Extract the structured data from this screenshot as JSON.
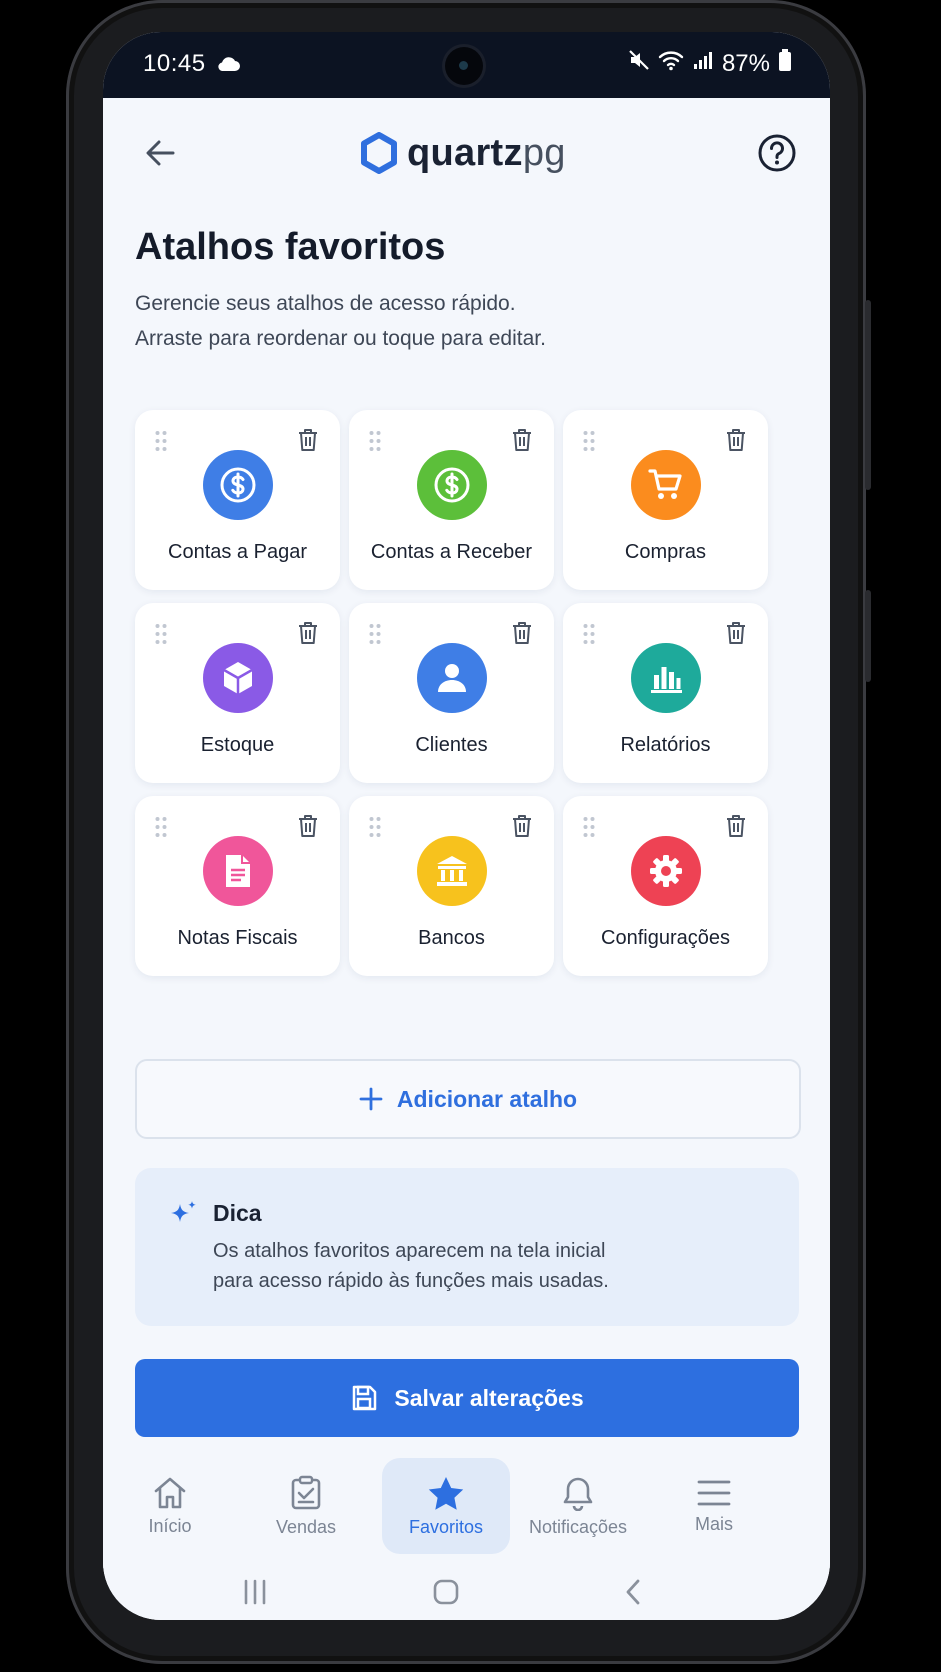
{
  "status_bar": {
    "time": "10:45",
    "battery": "87%"
  },
  "header": {
    "logo_main": "quartz",
    "logo_suffix": "pg",
    "back_icon": "arrow-left-icon",
    "help_icon": "help-circle-icon"
  },
  "page": {
    "title": "Atalhos favoritos",
    "subtitle_line1": "Gerencie seus atalhos de acesso rápido.",
    "subtitle_line2": "Arraste para reordenar ou toque para editar."
  },
  "shortcuts": [
    {
      "label": "Contas a Pagar",
      "icon": "dollar-icon",
      "color": "#3f7ee6"
    },
    {
      "label": "Contas a Receber",
      "icon": "dollar-icon",
      "color": "#5cbf3a"
    },
    {
      "label": "Compras",
      "icon": "cart-icon",
      "color": "#fb8c1e"
    },
    {
      "label": "Estoque",
      "icon": "box-icon",
      "color": "#8a5ae6"
    },
    {
      "label": "Clientes",
      "icon": "user-icon",
      "color": "#3f7ee6"
    },
    {
      "label": "Relatórios",
      "icon": "bar-chart-icon",
      "color": "#1eaa9b"
    },
    {
      "label": "Notas Fiscais",
      "icon": "document-icon",
      "color": "#f0569a"
    },
    {
      "label": "Bancos",
      "icon": "bank-icon",
      "color": "#f7c21d"
    },
    {
      "label": "Configurações",
      "icon": "gear-icon",
      "color": "#ee4254"
    }
  ],
  "add_button": {
    "label": "Adicionar atalho"
  },
  "tip": {
    "title": "Dica",
    "line1": "Os atalhos favoritos aparecem na tela inicial",
    "line2": "para acesso rápido às funções mais usadas."
  },
  "save_button": {
    "label": "Salvar alterações"
  },
  "bottom_nav": [
    {
      "label": "Início",
      "icon": "home-icon"
    },
    {
      "label": "Vendas",
      "icon": "clipboard-check-icon"
    },
    {
      "label": "Favoritos",
      "icon": "star-icon",
      "active": true
    },
    {
      "label": "Notificações",
      "icon": "bell-icon"
    },
    {
      "label": "Mais",
      "icon": "menu-icon"
    }
  ],
  "colors": {
    "primary": "#2d6fe0",
    "text_dark": "#141b2a",
    "background": "#f4f7fc"
  }
}
